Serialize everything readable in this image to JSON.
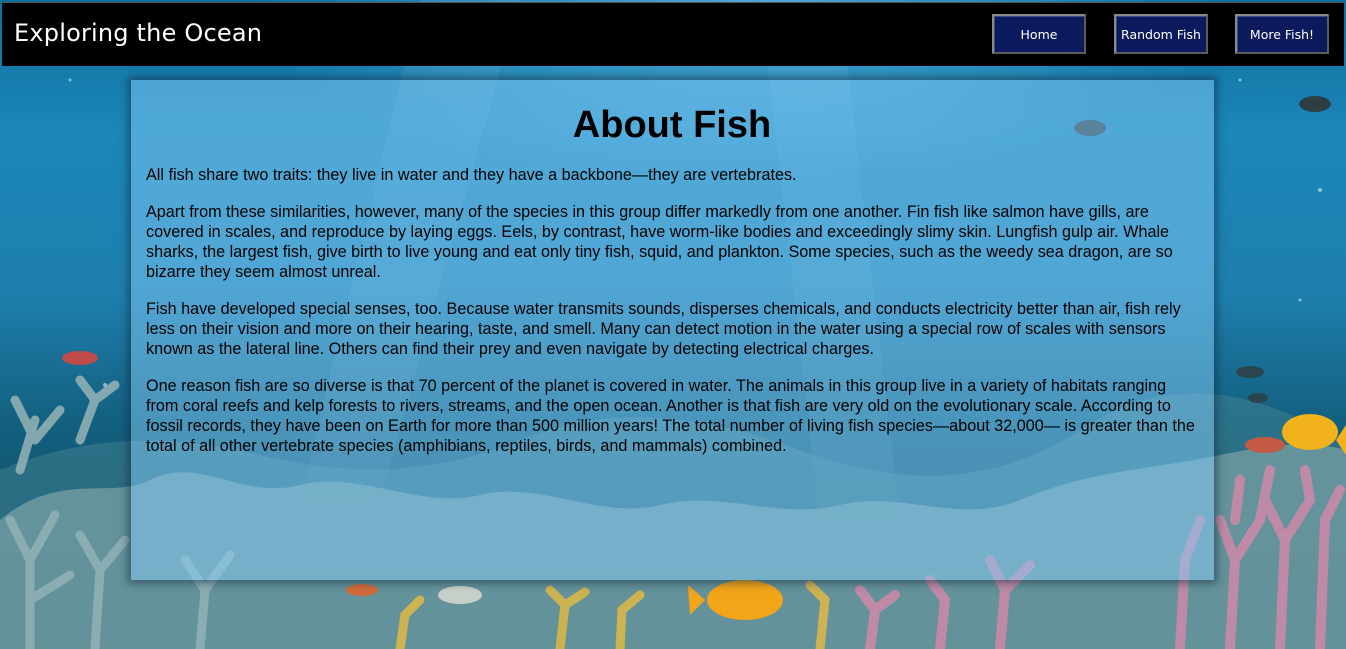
{
  "header": {
    "site_title": "Exploring the Ocean",
    "nav": [
      {
        "label": "Home"
      },
      {
        "label": "Random Fish"
      },
      {
        "label": "More Fish!"
      }
    ],
    "nav_color": "#0b1a5c"
  },
  "main": {
    "heading": "About Fish",
    "paragraphs": [
      "All fish share two traits: they live in water and they have a backbone—they are vertebrates.",
      "Apart from these similarities, however, many of the species in this group differ markedly from one another. Fin fish like salmon have gills, are covered in scales, and reproduce by laying eggs. Eels, by contrast, have worm-like bodies and exceedingly slimy skin. Lungfish gulp air. Whale sharks, the largest fish, give birth to live young and eat only tiny fish, squid, and plankton. Some species, such as the weedy sea dragon, are so bizarre they seem almost unreal.",
      "Fish have developed special senses, too. Because water transmits sounds, disperses chemicals, and conducts electricity better than air, fish rely less on their vision and more on their hearing, taste, and smell. Many can detect motion in the water using a special row of scales with sensors known as the lateral line. Others can find their prey and even navigate by detecting electrical charges.",
      "One reason fish are so diverse is that 70 percent of the planet is covered in water. The animals in this group live in a variety of habitats ranging from coral reefs and kelp forests to rivers, streams, and the open ocean. Another is that fish are very old on the evolutionary scale. According to fossil records, they have been on Earth for more than 500 million years! The total number of living fish species—about 32,000— is greater than the total of all other vertebrate species (amphibians, reptiles, birds, and mammals) combined."
    ]
  },
  "background": {
    "description_icon": "coral-reef-background",
    "water_color": "#1b86b8"
  }
}
